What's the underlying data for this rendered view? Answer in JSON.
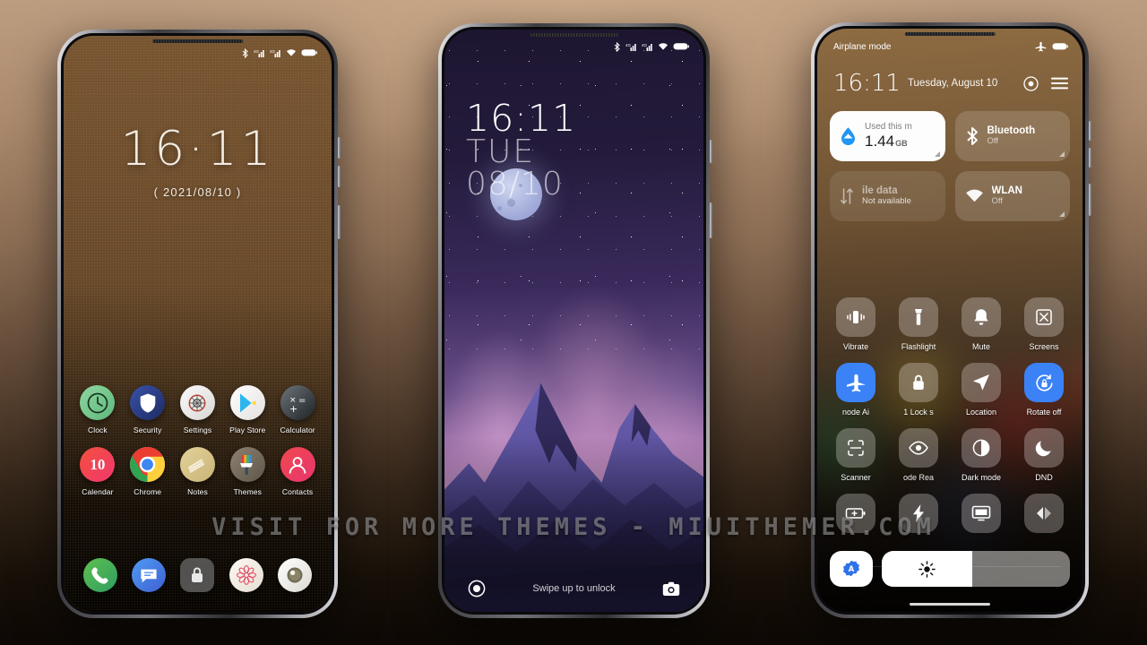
{
  "watermark": "VISIT FOR MORE THEMES - MIUITHEMER.COM",
  "phone1": {
    "name": "home-screen",
    "statusbar": {
      "icons": [
        "bluetooth-icon",
        "signal-icon",
        "signal-icon",
        "wifi-icon",
        "battery-icon"
      ]
    },
    "clock": {
      "time": "16·11",
      "date": "( 2021/08/10 )"
    },
    "apps_row1": [
      {
        "label": "Clock",
        "icon": "clock-icon"
      },
      {
        "label": "Security",
        "icon": "shield-icon"
      },
      {
        "label": "Settings",
        "icon": "gear-icon"
      },
      {
        "label": "Play Store",
        "icon": "play-store-icon"
      },
      {
        "label": "Calculator",
        "icon": "calculator-icon"
      }
    ],
    "apps_row2": [
      {
        "label": "Calendar",
        "icon": "calendar-icon",
        "day": "10"
      },
      {
        "label": "Chrome",
        "icon": "chrome-icon"
      },
      {
        "label": "Notes",
        "icon": "notes-icon"
      },
      {
        "label": "Themes",
        "icon": "themes-brush-icon"
      },
      {
        "label": "Contacts",
        "icon": "contacts-icon"
      }
    ],
    "dock": [
      {
        "label": "Phone",
        "icon": "phone-icon"
      },
      {
        "label": "Messages",
        "icon": "message-icon"
      },
      {
        "label": "App Lock",
        "icon": "lock-icon"
      },
      {
        "label": "Gallery",
        "icon": "flower-gallery-icon"
      },
      {
        "label": "Camera",
        "icon": "camera-lens-icon"
      }
    ]
  },
  "phone2": {
    "name": "lock-screen",
    "statusbar": {
      "icons": [
        "bluetooth-icon",
        "signal-icon",
        "signal-icon",
        "wifi-icon",
        "battery-icon"
      ]
    },
    "clock": {
      "time": "16:11",
      "day": "TUE",
      "date": "08/10"
    },
    "bottom": {
      "left_icon": "voice-assistant-icon",
      "hint": "Swipe up to unlock",
      "right_icon": "camera-icon"
    }
  },
  "phone3": {
    "name": "control-center",
    "statusbar": {
      "left": "Airplane mode",
      "icons": [
        "airplane-icon",
        "battery-icon"
      ]
    },
    "header": {
      "time": "16:11",
      "date": "Tuesday, August 10",
      "actions": [
        "power-icon",
        "menu-icon"
      ]
    },
    "big_tiles": [
      {
        "title": "Used this m",
        "value": "1.44",
        "unit": "GB",
        "icon": "data-drop-icon",
        "style": "light"
      },
      {
        "title": "Bluetooth",
        "sub": "Off",
        "icon": "bluetooth-icon",
        "style": "normal"
      },
      {
        "title": "ile data",
        "sub": "Not available",
        "icon": "mobile-data-icon",
        "style": "dim"
      },
      {
        "title": "WLAN",
        "sub": "Off",
        "icon": "wifi-icon",
        "style": "normal"
      }
    ],
    "toggle_rows": [
      [
        {
          "label": "Vibrate",
          "icon": "vibrate-icon",
          "on": false
        },
        {
          "label": "Flashlight",
          "icon": "flashlight-icon",
          "on": false
        },
        {
          "label": "Mute",
          "icon": "bell-mute-icon",
          "on": false
        },
        {
          "label": "Screens",
          "icon": "screenshot-icon",
          "on": false
        }
      ],
      [
        {
          "label": "node    Ai",
          "icon": "airplane-icon",
          "on": true
        },
        {
          "label": "1    Lock s",
          "icon": "lock-icon",
          "on": false
        },
        {
          "label": "Location",
          "icon": "location-icon",
          "on": false
        },
        {
          "label": "Rotate off",
          "icon": "rotate-lock-icon",
          "on": true
        }
      ],
      [
        {
          "label": "Scanner",
          "icon": "scanner-icon",
          "on": false
        },
        {
          "label": "ode    Rea",
          "icon": "reading-eye-icon",
          "on": false
        },
        {
          "label": "Dark mode",
          "icon": "dark-mode-icon",
          "on": false
        },
        {
          "label": "DND",
          "icon": "moon-icon",
          "on": false
        }
      ],
      [
        {
          "label": "",
          "icon": "battery-saver-icon",
          "on": false
        },
        {
          "label": "",
          "icon": "lightning-icon",
          "on": false
        },
        {
          "label": "",
          "icon": "cast-screen-icon",
          "on": false
        },
        {
          "label": "",
          "icon": "second-space-icon",
          "on": false
        }
      ]
    ],
    "brightness": {
      "auto_icon": "auto-brightness-icon",
      "slider_icon": "brightness-sun-icon",
      "level_percent": 48
    }
  }
}
